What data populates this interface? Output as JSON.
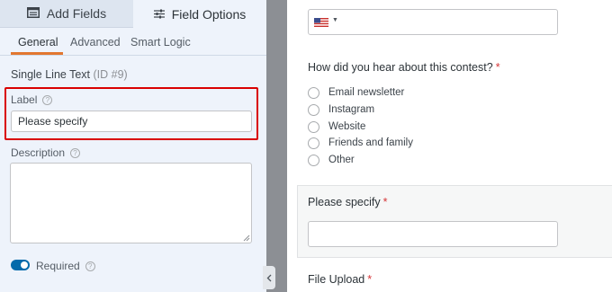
{
  "tabs": {
    "add_fields": {
      "label": "Add Fields",
      "icon": "form-icon"
    },
    "field_options": {
      "label": "Field Options",
      "icon": "sliders-icon"
    }
  },
  "subtabs": [
    "General",
    "Advanced",
    "Smart Logic"
  ],
  "field": {
    "type_label": "Single Line Text",
    "id_label": "(ID #9)"
  },
  "label_field": {
    "caption": "Label",
    "value": "Please specify"
  },
  "description_field": {
    "caption": "Description",
    "value": ""
  },
  "required_toggle": {
    "label": "Required",
    "on": true
  },
  "preview": {
    "question": "How did you hear about this contest?",
    "required_marker": "*",
    "options": [
      "Email newsletter",
      "Instagram",
      "Website",
      "Friends and family",
      "Other"
    ],
    "specify_title": "Please specify",
    "upload_title": "File Upload"
  },
  "colors": {
    "accent": "#e27730",
    "highlight": "#d90000",
    "toggle": "#036aab",
    "required": "#d63638"
  }
}
